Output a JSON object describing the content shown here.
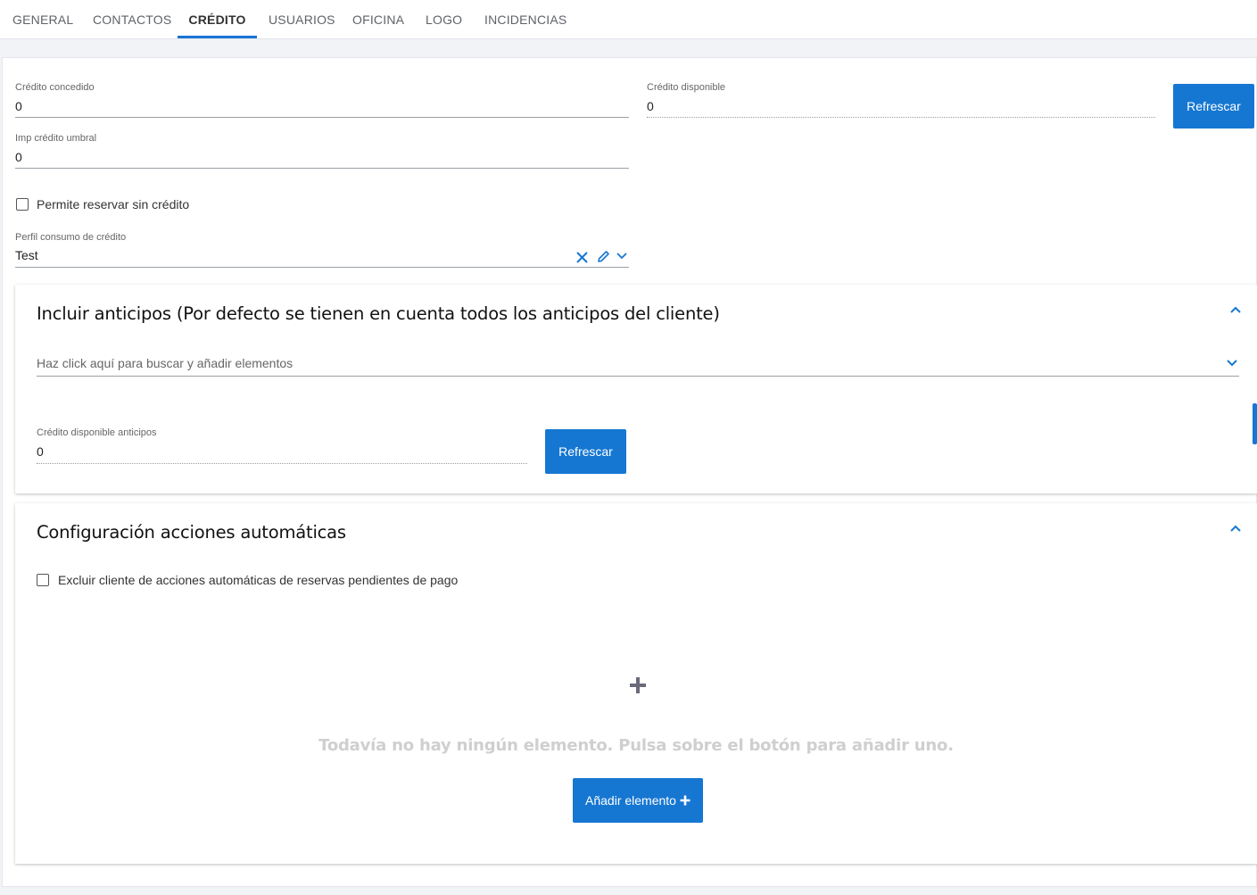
{
  "tabs": [
    {
      "label": "GENERAL"
    },
    {
      "label": "CONTACTOS"
    },
    {
      "label": "CRÉDITO"
    },
    {
      "label": "USUARIOS"
    },
    {
      "label": "OFICINA"
    },
    {
      "label": "LOGO"
    },
    {
      "label": "INCIDENCIAS"
    }
  ],
  "credit": {
    "granted_label": "Crédito concedido",
    "granted_value": "0",
    "available_label": "Crédito disponible",
    "available_value": "0",
    "refresh_label": "Refrescar",
    "threshold_label": "Imp crédito umbral",
    "threshold_value": "0",
    "allow_reserve_label": "Permite reservar sin crédito",
    "profile_label": "Perfil consumo de crédito",
    "profile_value": "Test"
  },
  "advances": {
    "title": "Incluir anticipos (Por defecto se tienen en cuenta todos los anticipos del cliente)",
    "search_placeholder": "Haz click aquí para buscar y añadir elementos",
    "available_label": "Crédito disponible anticipos",
    "available_value": "0",
    "refresh_label": "Refrescar"
  },
  "automatic": {
    "title": "Configuración acciones automáticas",
    "exclude_label": "Excluir cliente de acciones automáticas de reservas pendientes de pago",
    "empty_message": "Todavía no hay ningún elemento. Pulsa sobre el botón para añadir uno.",
    "add_label": "Añadir elemento"
  },
  "colors": {
    "accent": "#1677d2",
    "background": "#f2f3f7"
  }
}
